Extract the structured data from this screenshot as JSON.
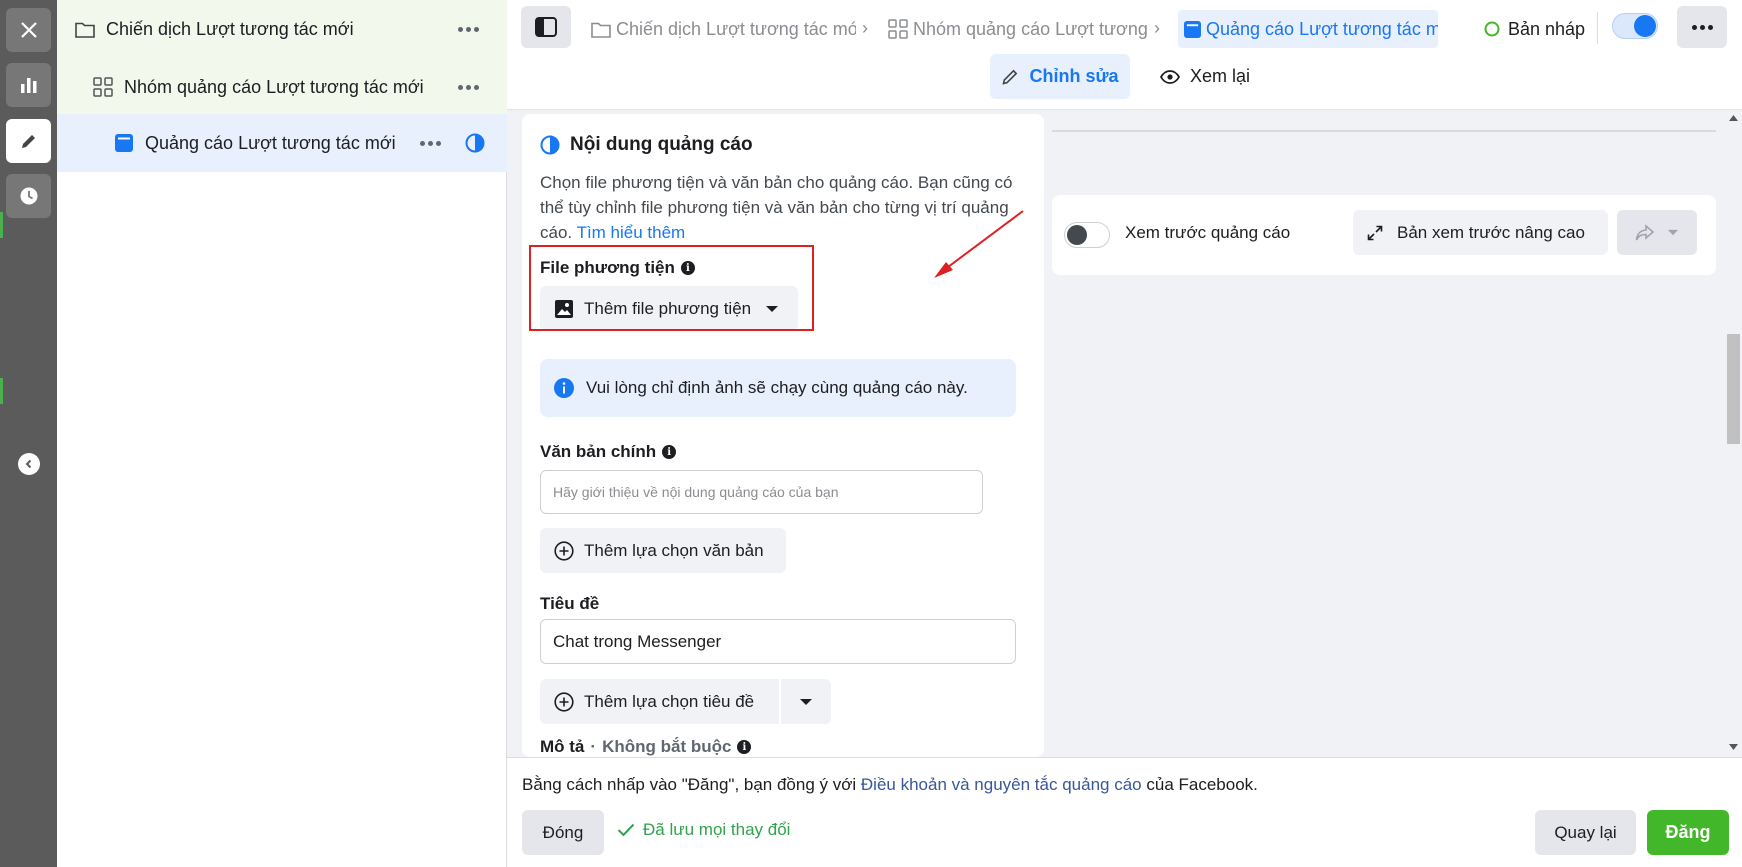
{
  "tree": {
    "campaign": "Chiến dịch Lượt tương tác mới",
    "adset": "Nhóm quảng cáo Lượt tương tác mới",
    "ad": "Quảng cáo Lượt tương tác mới"
  },
  "header": {
    "crumbs": [
      {
        "label": "Chiến dịch Lượt tương tác mới",
        "icon": "folder-icon"
      },
      {
        "label": "Nhóm quảng cáo Lượt tương",
        "icon": "grid-icon"
      },
      {
        "label": "Quảng cáo Lượt tương tác mới",
        "icon": "ad-icon"
      }
    ],
    "status": "Bản nháp",
    "tabs": {
      "edit": "Chỉnh sửa",
      "review": "Xem lại"
    }
  },
  "content": {
    "title": "Nội dung quảng cáo",
    "description": "Chọn file phương tiện và văn bản cho quảng cáo. Bạn cũng có thể tùy chỉnh file phương tiện và văn bản cho từng vị trí quảng cáo.",
    "learn_more": "Tìm hiểu thêm",
    "media_label": "File phương tiện",
    "add_media": "Thêm file phương tiện",
    "media_notice": "Vui lòng chỉ định ảnh sẽ chạy cùng quảng cáo này.",
    "primary_text_label": "Văn bản chính",
    "primary_text_placeholder": "Hãy giới thiệu về nội dung quảng cáo của bạn",
    "add_text_option": "Thêm lựa chọn văn bản",
    "headline_label": "Tiêu đề",
    "headline_value": "Chat trong Messenger",
    "add_headline_option": "Thêm lựa chọn tiêu đề",
    "description_label": "Mô tả",
    "optional": "Không bắt buộc"
  },
  "preview": {
    "toggle_label": "Xem trước quảng cáo",
    "advanced": "Bản xem trước nâng cao"
  },
  "footer": {
    "terms_prefix": "Bằng cách nhấp vào \"Đăng\", bạn đồng ý với",
    "terms_link": "Điều khoản và nguyên tắc quảng cáo",
    "terms_suffix": "của Facebook.",
    "close": "Đóng",
    "saved": "Đã lưu mọi thay đổi",
    "back": "Quay lại",
    "publish": "Đăng"
  },
  "colors": {
    "accent": "#1877f2",
    "publish": "#42b72a",
    "saved": "#31a24c",
    "annotation": "#e02020"
  }
}
